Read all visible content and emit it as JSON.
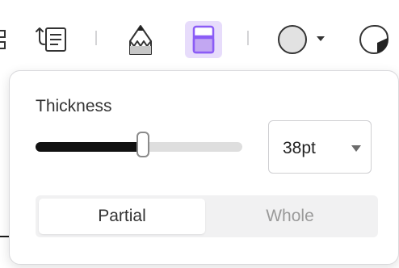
{
  "toolbar": {
    "tools": [
      {
        "name": "partial-icon",
        "active": false
      },
      {
        "name": "list-text-icon",
        "active": false
      },
      {
        "name": "pencil-icon",
        "active": false
      },
      {
        "name": "eraser-icon",
        "active": true
      },
      {
        "name": "color-circle-icon",
        "active": false
      },
      {
        "name": "shape-sticker-icon",
        "active": false
      }
    ],
    "active_color": "#e7dcfb"
  },
  "eraser_popover": {
    "thickness_label": "Thickness",
    "slider_value_fraction": 0.52,
    "size_value": "38pt",
    "mode_options": [
      "Partial",
      "Whole"
    ],
    "selected_mode": "Partial"
  },
  "colors": {
    "accent": "#e7dcfb",
    "eraser_purple": "#8b5cf6"
  }
}
